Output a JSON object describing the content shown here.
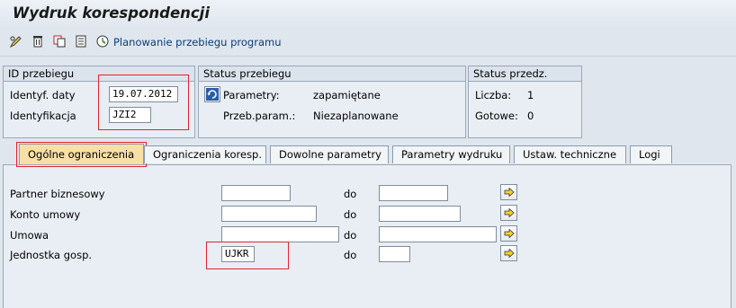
{
  "window": {
    "title": "Wydruk korespondencji"
  },
  "toolbar": {
    "icons": [
      "pencil-glasses-icon",
      "trash-icon",
      "copy-icon",
      "list-icon",
      "clock-run-icon"
    ],
    "schedule_label": "Planowanie przebiegu programu"
  },
  "run_id": {
    "header": "ID przebiegu",
    "date_label": "Identyf. daty",
    "date_value": "19.07.2012",
    "id_label": "Identyfikacja",
    "id_value": "JZI2"
  },
  "run_status": {
    "header": "Status przebiegu",
    "params_label": "Parametry:",
    "params_value": "zapamiętane",
    "sched_label": "Przeb.param.:",
    "sched_value": "Niezaplanowane"
  },
  "pre_status": {
    "header": "Status przedz.",
    "count_label": "Liczba:",
    "count_value": "1",
    "ready_label": "Gotowe:",
    "ready_value": "0"
  },
  "tabs": [
    {
      "label": "Ogólne ograniczenia",
      "active": true
    },
    {
      "label": "Ograniczenia koresp."
    },
    {
      "label": "Dowolne parametry"
    },
    {
      "label": "Parametry wydruku"
    },
    {
      "label": "Ustaw. techniczne"
    },
    {
      "label": "Logi"
    }
  ],
  "criteria": {
    "to_label": "do",
    "rows": [
      {
        "label": "Partner biznesowy",
        "from": "",
        "to": ""
      },
      {
        "label": "Konto umowy",
        "from": "",
        "to": ""
      },
      {
        "label": "Umowa",
        "from": "",
        "to": ""
      },
      {
        "label": "Jednostka gosp.",
        "from": "UJKR",
        "to": ""
      }
    ]
  },
  "colors": {
    "highlight": "#e0262b",
    "active_tab": "#f7dfa6",
    "link": "#0c3c78"
  }
}
